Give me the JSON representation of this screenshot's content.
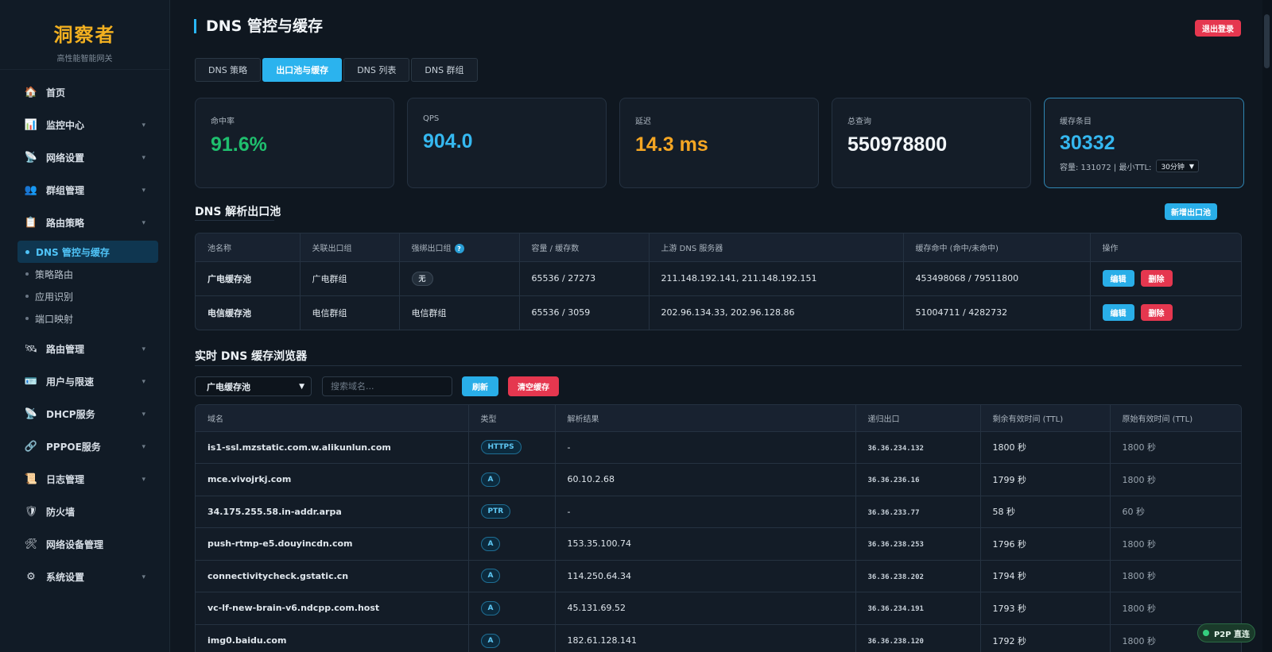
{
  "brand": {
    "title": "洞察者",
    "subtitle": "高性能智能网关"
  },
  "sidebar": {
    "items": [
      {
        "label": "首页",
        "icon": "home-icon",
        "glyph": "🏠",
        "chev": false
      },
      {
        "label": "监控中心",
        "icon": "chart-icon",
        "glyph": "📊",
        "chev": true
      },
      {
        "label": "网络设置",
        "icon": "satellite-icon",
        "glyph": "📡",
        "chev": true
      },
      {
        "label": "群组管理",
        "icon": "group-icon",
        "glyph": "👥",
        "chev": true
      },
      {
        "label": "路由策略",
        "icon": "clipboard-icon",
        "glyph": "📋",
        "chev": true
      }
    ],
    "sub_items": [
      {
        "label": "DNS 管控与缓存",
        "active": true
      },
      {
        "label": "策略路由",
        "active": false
      },
      {
        "label": "应用识别",
        "active": false
      },
      {
        "label": "端口映射",
        "active": false
      }
    ],
    "items_after": [
      {
        "label": "路由管理",
        "icon": "route-icon",
        "glyph": "🛰",
        "chev": true
      },
      {
        "label": "用户与限速",
        "icon": "user-card-icon",
        "glyph": "🪪",
        "chev": true
      },
      {
        "label": "DHCP服务",
        "icon": "satellite-icon",
        "glyph": "📡",
        "chev": true
      },
      {
        "label": "PPPOE服务",
        "icon": "link-icon",
        "glyph": "🔗",
        "chev": true
      },
      {
        "label": "日志管理",
        "icon": "scroll-icon",
        "glyph": "📜",
        "chev": true
      },
      {
        "label": "防火墙",
        "icon": "shield-icon",
        "glyph": "🛡",
        "chev": false
      },
      {
        "label": "网络设备管理",
        "icon": "tools-icon",
        "glyph": "🛠",
        "chev": false
      },
      {
        "label": "系统设置",
        "icon": "gear-icon",
        "glyph": "⚙",
        "chev": true
      }
    ]
  },
  "header": {
    "title": "DNS 管控与缓存",
    "logout": "退出登录"
  },
  "tabs": [
    "DNS 策略",
    "出口池与缓存",
    "DNS 列表",
    "DNS 群组"
  ],
  "active_tab": 1,
  "stats": {
    "hit_rate": {
      "label": "命中率",
      "value": "91.6%",
      "color": "#1fbf6e"
    },
    "qps": {
      "label": "QPS",
      "value": "904.0",
      "color": "#35b8f0"
    },
    "latency": {
      "label": "延迟",
      "value": "14.3 ms",
      "color": "#f5a623"
    },
    "total": {
      "label": "总查询",
      "value": "550978800",
      "color": "#f2f6f9"
    },
    "cache": {
      "label": "缓存条目",
      "value": "30332",
      "color": "#35b8f0",
      "extra": "容量: 131072 | 最小TTL:",
      "ttl": "30分钟"
    }
  },
  "pools": {
    "title": "DNS 解析出口池",
    "add_button": "新增出口池",
    "headers": [
      "池名称",
      "关联出口组",
      "强绑出口组",
      "容量 / 缓存数",
      "上游 DNS 服务器",
      "缓存命中 (命中/未命中)",
      "操作"
    ],
    "rows": [
      {
        "name": "广电缓存池",
        "group": "广电群组",
        "bind": "无",
        "capacity": "65536 / 27273",
        "upstream": "211.148.192.141, 211.148.192.151",
        "hits": "453498068 / 79511800"
      },
      {
        "name": "电信缓存池",
        "group": "电信群组",
        "bind": "电信群组",
        "capacity": "65536 / 3059",
        "upstream": "202.96.134.33, 202.96.128.86",
        "hits": "51004711 / 4282732"
      }
    ],
    "edit": "编辑",
    "delete": "删除"
  },
  "browser": {
    "title": "实时 DNS 缓存浏览器",
    "pool_selected": "广电缓存池",
    "search_placeholder": "搜索域名...",
    "refresh": "刷新",
    "clear": "清空缓存",
    "headers": [
      "域名",
      "类型",
      "解析结果",
      "递归出口",
      "剩余有效时间 (TTL)",
      "原始有效时间 (TTL)"
    ],
    "rows": [
      {
        "domain": "is1-ssl.mzstatic.com.w.alikunlun.com",
        "type": "HTTPS",
        "result": "-",
        "egress": "36.36.234.132",
        "remain": "1800 秒",
        "orig": "1800 秒"
      },
      {
        "domain": "mce.vivojrkj.com",
        "type": "A",
        "result": "60.10.2.68",
        "egress": "36.36.236.16",
        "remain": "1799 秒",
        "orig": "1800 秒"
      },
      {
        "domain": "34.175.255.58.in-addr.arpa",
        "type": "PTR",
        "result": "-",
        "egress": "36.36.233.77",
        "remain": "58 秒",
        "orig": "60 秒"
      },
      {
        "domain": "push-rtmp-e5.douyincdn.com",
        "type": "A",
        "result": "153.35.100.74",
        "egress": "36.36.238.253",
        "remain": "1796 秒",
        "orig": "1800 秒"
      },
      {
        "domain": "connectivitycheck.gstatic.cn",
        "type": "A",
        "result": "114.250.64.34",
        "egress": "36.36.238.202",
        "remain": "1794 秒",
        "orig": "1800 秒"
      },
      {
        "domain": "vc-lf-new-brain-v6.ndcpp.com.host",
        "type": "A",
        "result": "45.131.69.52",
        "egress": "36.36.234.191",
        "remain": "1793 秒",
        "orig": "1800 秒"
      },
      {
        "domain": "img0.baidu.com",
        "type": "A",
        "result": "182.61.128.141",
        "egress": "36.36.238.120",
        "remain": "1792 秒",
        "orig": "1800 秒"
      }
    ]
  },
  "p2p": "P2P 直连"
}
